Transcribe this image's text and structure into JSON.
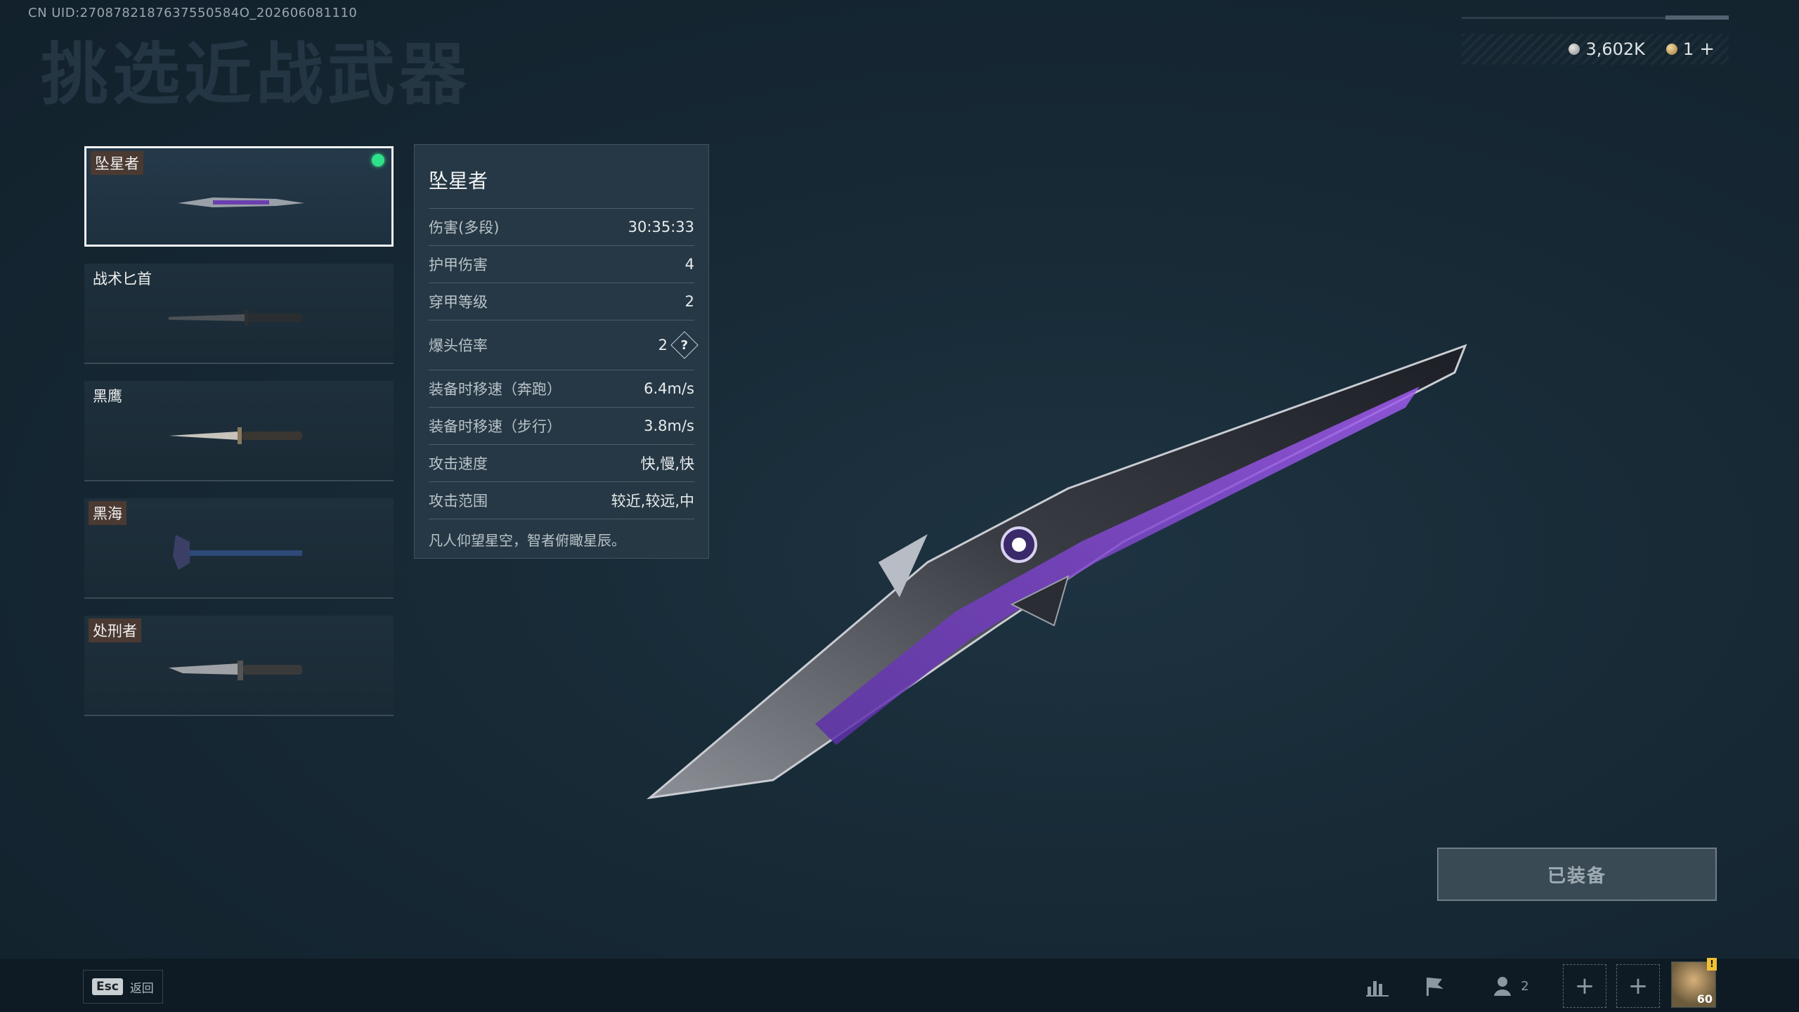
{
  "uid_text": "CN UID:2708782187637550584O_202606081110",
  "page_title": "挑选近战武器",
  "currency": {
    "silver": "3,602K",
    "gold": "1"
  },
  "weapons": [
    {
      "name": "坠星者",
      "equipped": true
    },
    {
      "name": "战术匕首",
      "equipped": false
    },
    {
      "name": "黑鹰",
      "equipped": false
    },
    {
      "name": "黑海",
      "equipped": false
    },
    {
      "name": "处刑者",
      "equipped": false
    }
  ],
  "stats": {
    "title": "坠星者",
    "rows": [
      {
        "label": "伤害(多段)",
        "value": "30:35:33"
      },
      {
        "label": "护甲伤害",
        "value": "4"
      },
      {
        "label": "穿甲等级",
        "value": "2"
      },
      {
        "label": "爆头倍率",
        "value": "2"
      },
      {
        "label": "装备时移速（奔跑）",
        "value": "6.4m/s"
      },
      {
        "label": "装备时移速（步行）",
        "value": "3.8m/s"
      },
      {
        "label": "攻击速度",
        "value": "快,慢,快"
      },
      {
        "label": "攻击范围",
        "value": "较近,较远,中"
      }
    ],
    "help_glyph": "?",
    "description": "凡人仰望星空，智者俯瞰星辰。"
  },
  "equip_button": "已装备",
  "bottom": {
    "esc_key": "Esc",
    "esc_label": "返回",
    "squad_count": "2",
    "avatar_level": "60"
  }
}
